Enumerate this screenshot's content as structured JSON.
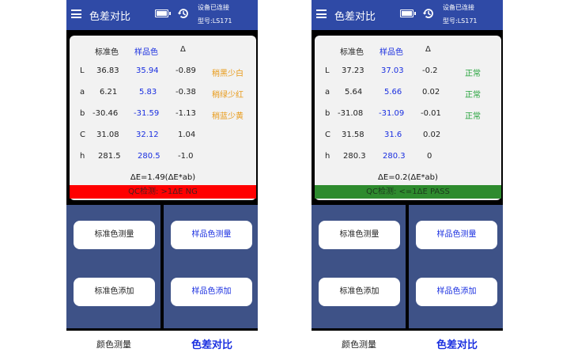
{
  "screens": [
    {
      "appbar": {
        "title": "色差对比",
        "connection": "设备已连接",
        "model": "型号:LS171"
      },
      "headers": {
        "standard": "标准色",
        "sample": "样品色",
        "delta": "Δ"
      },
      "rows": [
        {
          "label": "L",
          "standard": "36.83",
          "sample": "35.94",
          "delta": "-0.89",
          "note": "稍黑少白"
        },
        {
          "label": "a",
          "standard": "6.21",
          "sample": "5.83",
          "delta": "-0.38",
          "note": "稍绿少红"
        },
        {
          "label": "b",
          "standard": "-30.46",
          "sample": "-31.59",
          "delta": "-1.13",
          "note": "稍蓝少黄"
        },
        {
          "label": "C",
          "standard": "31.08",
          "sample": "32.12",
          "delta": "1.04",
          "note": ""
        },
        {
          "label": "h",
          "standard": "281.5",
          "sample": "280.5",
          "delta": "-1.0",
          "note": ""
        }
      ],
      "delta_e": "ΔE=1.49(ΔE*ab)",
      "qc": {
        "text": "QC检测: >1ΔE  NG",
        "color": "#ff0000"
      },
      "buttons": {
        "std_measure": "标准色测量",
        "smp_measure": "样品色测量",
        "std_add": "标准色添加",
        "smp_add": "样品色添加"
      },
      "nav": {
        "color_measure": "颜色测量",
        "color_diff": "色差对比"
      }
    },
    {
      "appbar": {
        "title": "色差对比",
        "connection": "设备已连接",
        "model": "型号:LS171"
      },
      "headers": {
        "standard": "标准色",
        "sample": "样品色",
        "delta": "Δ"
      },
      "rows": [
        {
          "label": "L",
          "standard": "37.23",
          "sample": "37.03",
          "delta": "-0.2",
          "note": "正常"
        },
        {
          "label": "a",
          "standard": "5.64",
          "sample": "5.66",
          "delta": "0.02",
          "note": "正常"
        },
        {
          "label": "b",
          "standard": "-31.08",
          "sample": "-31.09",
          "delta": "-0.01",
          "note": "正常"
        },
        {
          "label": "C",
          "standard": "31.58",
          "sample": "31.6",
          "delta": "0.02",
          "note": ""
        },
        {
          "label": "h",
          "standard": "280.3",
          "sample": "280.3",
          "delta": "0",
          "note": ""
        }
      ],
      "delta_e": "ΔE=0.2(ΔE*ab)",
      "qc": {
        "text": "QC检测: <=1ΔE  PASS",
        "color": "#2e8b2e"
      },
      "buttons": {
        "std_measure": "标准色测量",
        "smp_measure": "样品色测量",
        "std_add": "标准色添加",
        "smp_add": "样品色添加"
      },
      "nav": {
        "color_measure": "颜色测量",
        "color_diff": "色差对比"
      }
    }
  ],
  "colors": {
    "appbar": "#2f4aa6",
    "panel": "#3e5287",
    "sample_text": "#1a2fe0",
    "warn_text": "#e89a18",
    "ok_text": "#23a23a"
  },
  "icons": {
    "menu": "hamburger-menu-icon",
    "battery": "battery-icon",
    "history": "history-clock-icon"
  }
}
